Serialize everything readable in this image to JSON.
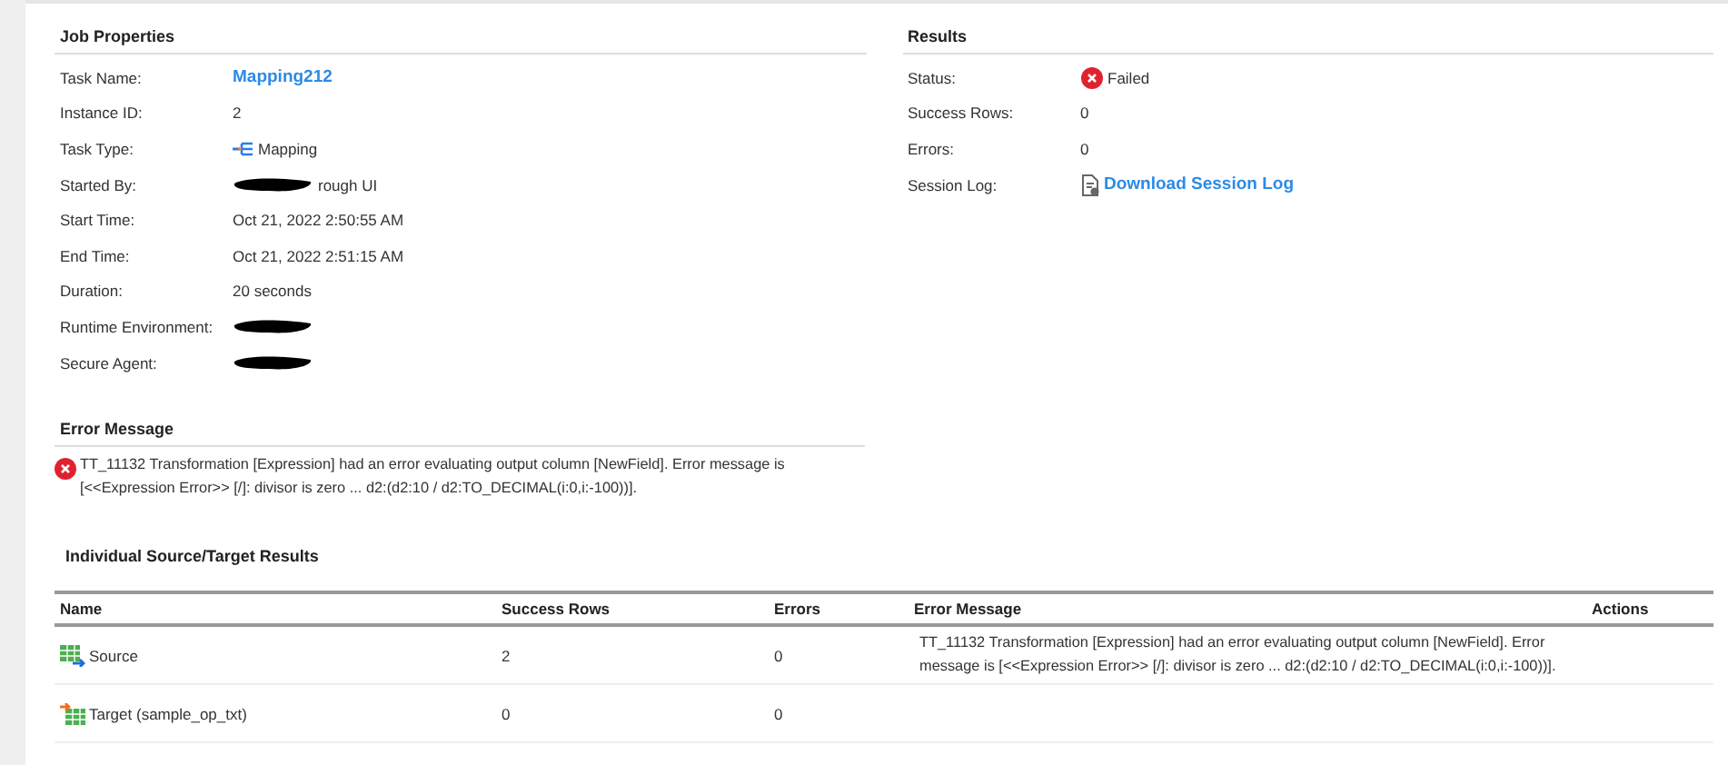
{
  "job_properties": {
    "title": "Job Properties",
    "rows": [
      {
        "label": "Task Name:",
        "kind": "link",
        "value": "Mapping212"
      },
      {
        "label": "Instance ID:",
        "kind": "text",
        "value": "2"
      },
      {
        "label": "Task Type:",
        "kind": "mapping",
        "value": "Mapping"
      },
      {
        "label": "Started By:",
        "kind": "redacted",
        "value": "rough UI"
      },
      {
        "label": "Start Time:",
        "kind": "text",
        "value": "Oct 21, 2022 2:50:55 AM"
      },
      {
        "label": "End Time:",
        "kind": "text",
        "value": "Oct 21, 2022 2:51:15 AM"
      },
      {
        "label": "Duration:",
        "kind": "text",
        "value": "20 seconds"
      },
      {
        "label": "Runtime Environment:",
        "kind": "redacted"
      },
      {
        "label": "Secure Agent:",
        "kind": "redacted"
      }
    ]
  },
  "results": {
    "title": "Results",
    "rows": [
      {
        "label": "Status:",
        "kind": "failed",
        "value": "Failed"
      },
      {
        "label": "Success Rows:",
        "kind": "text",
        "value": "0"
      },
      {
        "label": "Errors:",
        "kind": "text",
        "value": "0"
      },
      {
        "label": "Session Log:",
        "kind": "download",
        "value": "Download Session Log"
      }
    ]
  },
  "error_message": {
    "title": "Error Message",
    "text": "TT_11132 Transformation [Expression] had an error evaluating output column [NewField]. Error message is [<<Expression Error>> [/]: divisor is zero ... d2:(d2:10 / d2:TO_DECIMAL(i:0,i:-100))]."
  },
  "source_target": {
    "title": "Individual Source/Target Results",
    "columns": [
      "Name",
      "Success Rows",
      "Errors",
      "Error Message",
      "Actions"
    ],
    "rows": [
      {
        "kind": "source",
        "name": "Source",
        "success_rows": "2",
        "errors": "0",
        "error_message": "TT_11132 Transformation [Expression] had an error evaluating output column [NewField]. Error message is [<<Expression Error>> [/]: divisor is zero ... d2:(d2:10 / d2:TO_DECIMAL(i:0,i:-100))]."
      },
      {
        "kind": "target",
        "name": "Target (sample_op_txt)",
        "success_rows": "0",
        "errors": "0"
      }
    ]
  }
}
